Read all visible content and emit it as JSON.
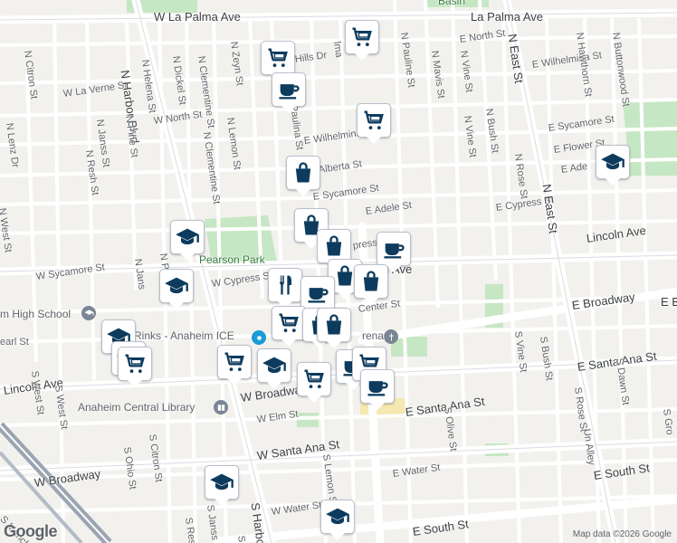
{
  "colors": {
    "pin_icon": "#0d3b5e",
    "park_green": "#c6e7c3",
    "major_road": "#ffffff",
    "highway": "#f7d57a",
    "land": "#f2f1ee"
  },
  "roads": {
    "w_la_palma": "W La Palma Ave",
    "la_palma": "La Palma Ave",
    "e_north_st": "E North St",
    "e_wilhelmina_top": "E Wilhelmina St",
    "e_wilhelmina_mid": "E Wilhelmina",
    "w_la_verne": "W La Verne St",
    "w_north": "W North St",
    "alberta": "Alberta St",
    "e_sycamore": "E Sycamore St",
    "e_sycamore_right": "E Sycamore St",
    "e_adele": "E Adele St",
    "e_adele_right": "E Ade",
    "e_flower": "E Flower St",
    "e_cypress": "E Cypress St",
    "cypress_mid": "press",
    "lincoln_right": "Lincoln Ave",
    "lincoln_mid": "ln Ave",
    "w_sycamore": "W Sycamore St",
    "w_cypress": "W Cypress St",
    "center": "Center St",
    "e_broadway": "E Broadway",
    "e_broadway_right": "E B",
    "e_santa_ana_right": "E Santa Ana St",
    "e_santa_ana_mid": "E Santa Ana St",
    "w_broadway_mid": "W Broadway",
    "w_broadway_left": "W Broadway",
    "lincoln_left": "Lincoln Ave",
    "w_elm": "W Elm St",
    "w_santa_ana": "W Santa Ana St",
    "e_water": "E Water St",
    "w_water": "W Water St",
    "e_south_bottom": "E South St",
    "e_south_right": "E South St",
    "pearl": "earl St",
    "n_citron": "N Citron St",
    "n_helena": "N Helena St",
    "n_dickel": "N Dickel St",
    "n_clementine_top": "N Clementine St",
    "n_zeyn": "N Zeyn St",
    "n_harbor": "N Harbor Blvd",
    "n_lenz": "N Lenz Dr",
    "n_pine": "N Pine St",
    "n_janss": "N Janss St",
    "n_resh": "N Resh St",
    "n_west": "N West St",
    "n_clementine_mid": "N Clementine St",
    "n_lemon": "N Lemon St",
    "paulina": "Paulina St",
    "n_pauline": "N Pauline St",
    "n_mavis": "N Mavis St",
    "n_vine_top": "N Vine St",
    "n_vine_mid": "N Vine St",
    "n_bush": "N Bush St",
    "n_east": "N East St",
    "n_east_mid": "N East St",
    "n_rose": "N Rose St",
    "n_hawthorn": "N Hawthorn St",
    "n_buttonwood": "N Buttonwood St",
    "n_janss_mid": "N Janss",
    "s_vine": "S Vine St",
    "s_bush": "S Bush St",
    "s_rose": "S Rose St",
    "un_alley": "Un Alley",
    "s_dawn": "S Dawn St",
    "s_olive": "S Olive St",
    "s_lemon": "S Lemon St",
    "s_citron": "S Citron St",
    "s_ohio": "S Ohio St",
    "s_janss": "S Janss St",
    "s_resh": "S Resh",
    "s_harbor": "S Harbo",
    "s_west": "S West St",
    "s_west2": "S West St",
    "s_manchester": "S Mancheste",
    "s_gro": "S Gro",
    "s_p": "S P",
    "n_p": "N P",
    "n_jans": "N Jans",
    "w_b": "n Ave",
    "n_e_alley": "N East St",
    "elma": "lma",
    "hills": "Hills Dr",
    "n_east_label": "N East St"
  },
  "places": {
    "basin": "Basin",
    "pearson_park": "Pearson Park",
    "high_school": "m High School",
    "rinks": "Rinks - Anaheim ICE",
    "library": "Anaheim Central Library",
    "arena": "rena"
  },
  "pins": [
    {
      "type": "shopping-cart",
      "name": "grocery-pin"
    },
    {
      "type": "shopping-cart",
      "name": "grocery-pin"
    },
    {
      "type": "coffee-cup",
      "name": "cafe-pin"
    },
    {
      "type": "shopping-cart",
      "name": "grocery-pin"
    },
    {
      "type": "shopping-bag",
      "name": "shopping-pin"
    },
    {
      "type": "graduation-cap",
      "name": "school-pin"
    },
    {
      "type": "shopping-bag",
      "name": "shopping-pin"
    },
    {
      "type": "shopping-bag",
      "name": "shopping-pin"
    },
    {
      "type": "coffee-cup",
      "name": "cafe-pin"
    },
    {
      "type": "graduation-cap",
      "name": "school-pin"
    },
    {
      "type": "graduation-cap",
      "name": "school-pin"
    },
    {
      "type": "shopping-bag",
      "name": "shopping-pin"
    },
    {
      "type": "shopping-bag",
      "name": "shopping-pin"
    },
    {
      "type": "fork-knife",
      "name": "restaurant-pin"
    },
    {
      "type": "coffee-cup",
      "name": "cafe-pin"
    },
    {
      "type": "shopping-cart",
      "name": "grocery-pin"
    },
    {
      "type": "shopping-bag",
      "name": "shopping-pin"
    },
    {
      "type": "shopping-bag",
      "name": "shopping-pin"
    },
    {
      "type": "graduation-cap",
      "name": "school-pin"
    },
    {
      "type": "graduation-cap",
      "name": "school-pin"
    },
    {
      "type": "shopping-cart",
      "name": "grocery-pin"
    },
    {
      "type": "graduation-cap",
      "name": "school-pin"
    },
    {
      "type": "shopping-cart",
      "name": "grocery-pin"
    },
    {
      "type": "coffee-cup",
      "name": "cafe-pin"
    },
    {
      "type": "shopping-cart",
      "name": "grocery-pin"
    },
    {
      "type": "coffee-cup",
      "name": "cafe-pin"
    },
    {
      "type": "graduation-cap",
      "name": "school-pin"
    },
    {
      "type": "graduation-cap",
      "name": "school-pin"
    },
    {
      "type": "shopping-cart",
      "name": "grocery-pin"
    }
  ],
  "attribution": "Map data ©2026 Google",
  "google_logo": "Google"
}
